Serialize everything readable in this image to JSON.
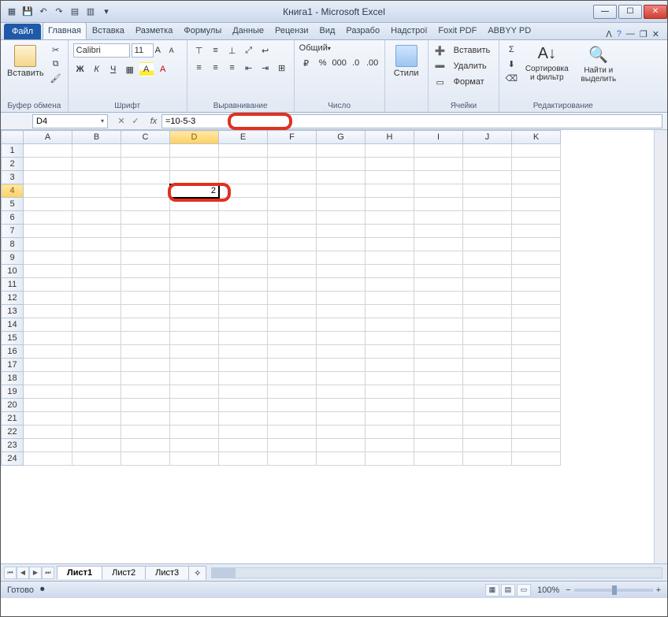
{
  "title": "Книга1 - Microsoft Excel",
  "tabs": {
    "file": "Файл",
    "items": [
      "Главная",
      "Вставка",
      "Разметка",
      "Формулы",
      "Данные",
      "Рецензи",
      "Вид",
      "Разрабо",
      "Надстрої",
      "Foxit PDF",
      "ABBYY PD"
    ],
    "active": 0
  },
  "ribbon": {
    "clipboard": {
      "paste": "Вставить",
      "label": "Буфер обмена"
    },
    "font": {
      "name": "Calibri",
      "size": "11",
      "label": "Шрифт"
    },
    "align": {
      "label": "Выравнивание"
    },
    "number": {
      "format": "Общий",
      "label": "Число"
    },
    "styles": {
      "btn": "Стили"
    },
    "cells": {
      "insert": "Вставить",
      "delete": "Удалить",
      "format": "Формат",
      "label": "Ячейки"
    },
    "editing": {
      "sort": "Сортировка и фильтр",
      "find": "Найти и выделить",
      "label": "Редактирование"
    }
  },
  "namebox": "D4",
  "formula": "=10-5-3",
  "columns": [
    "A",
    "B",
    "C",
    "D",
    "E",
    "F",
    "G",
    "H",
    "I",
    "J",
    "K"
  ],
  "rows": 24,
  "activeCell": {
    "row": 4,
    "col": "D",
    "value": "2"
  },
  "sheets": {
    "items": [
      "Лист1",
      "Лист2",
      "Лист3"
    ],
    "active": 0
  },
  "status": {
    "ready": "Готово",
    "zoom": "100%"
  }
}
